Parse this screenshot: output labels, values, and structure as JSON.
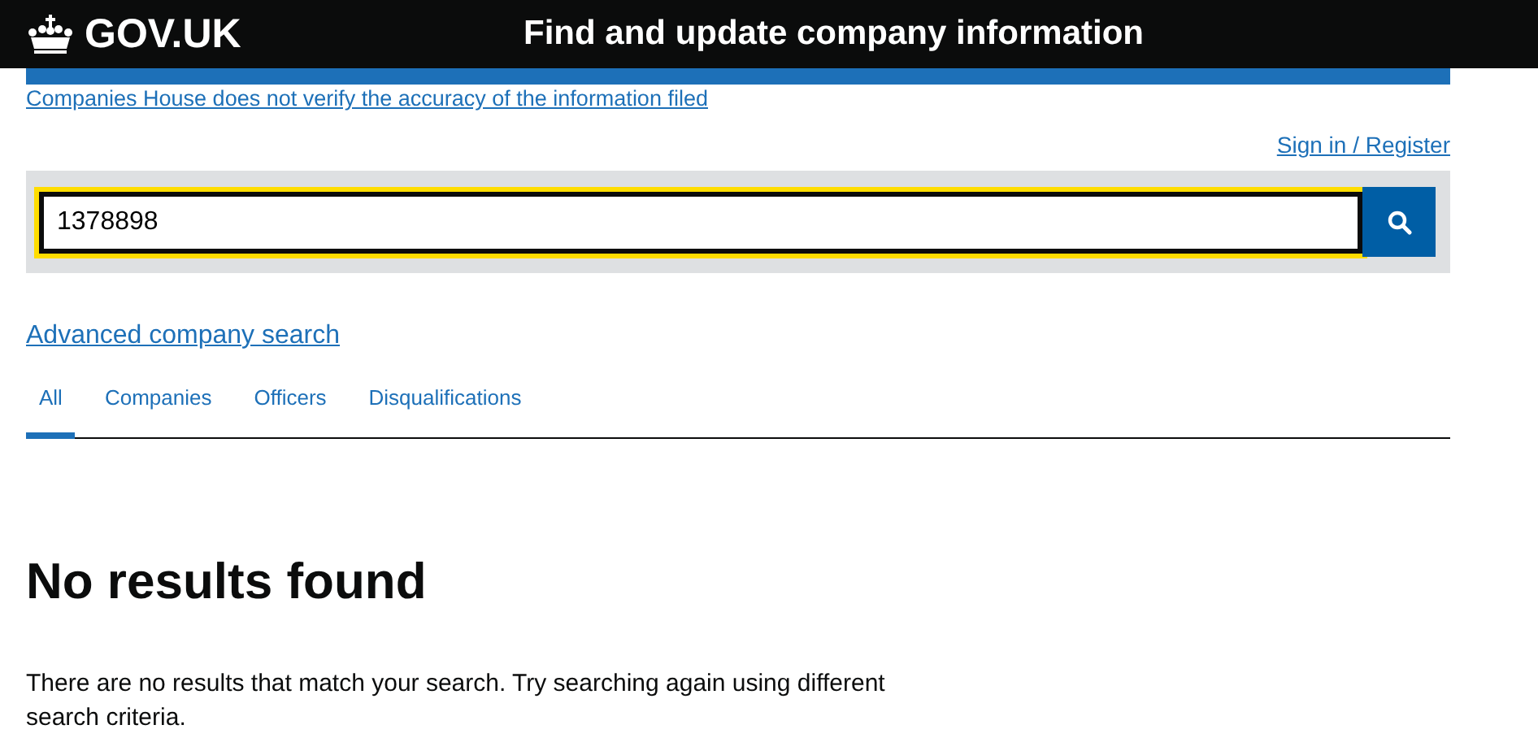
{
  "header": {
    "logo": "GOV.UK",
    "service_name": "Find and update company information"
  },
  "notice_link": "Companies House does not verify the accuracy of the information filed",
  "account_link": "Sign in / Register",
  "search": {
    "value": "1378898"
  },
  "advanced_link": "Advanced company search",
  "tabs": [
    {
      "label": "All",
      "selected": true
    },
    {
      "label": "Companies",
      "selected": false
    },
    {
      "label": "Officers",
      "selected": false
    },
    {
      "label": "Disqualifications",
      "selected": false
    }
  ],
  "heading": "No results found",
  "message": "There are no results that match your search. Try searching again using different search criteria."
}
